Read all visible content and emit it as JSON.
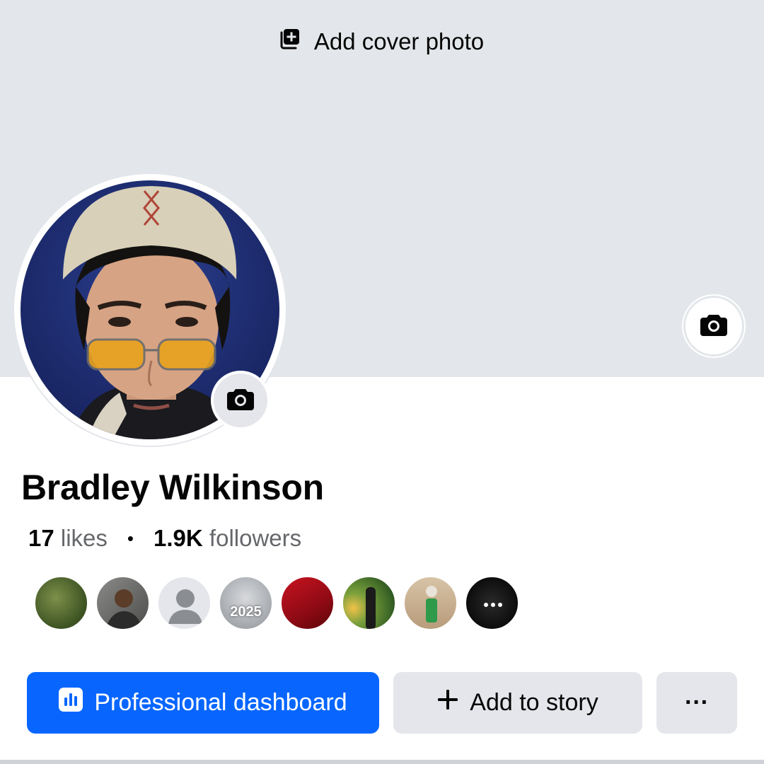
{
  "cover": {
    "add_cover_label": "Add cover photo"
  },
  "profile": {
    "name": "Bradley Wilkinson",
    "likes_count": "17",
    "likes_label": "likes",
    "followers_count": "1.9K",
    "followers_label": "followers",
    "separator": "•"
  },
  "friends_preview": [
    {
      "name": "friend-1",
      "color": "#4a6b2f"
    },
    {
      "name": "friend-2",
      "color": "#6b6a66"
    },
    {
      "name": "friend-3",
      "color": "#e4e6eb"
    },
    {
      "name": "friend-4",
      "color": "#9a9ea4"
    },
    {
      "name": "friend-5",
      "color": "#b0101c"
    },
    {
      "name": "friend-6",
      "color": "#3f6d2a"
    },
    {
      "name": "friend-7",
      "color": "#c3a98a"
    },
    {
      "name": "friend-8",
      "color": "#111111"
    }
  ],
  "friend_4_text": "2025",
  "actions": {
    "primary_label": "Professional dashboard",
    "story_label": "Add to story",
    "more_label": "···"
  },
  "colors": {
    "accent": "#0866ff",
    "cover_bg": "#e3e6ea",
    "button_gray": "#e4e6eb"
  }
}
